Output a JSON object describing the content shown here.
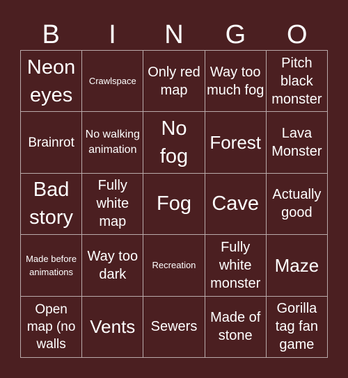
{
  "header": {
    "letters": [
      "B",
      "I",
      "N",
      "G",
      "O"
    ]
  },
  "colors": {
    "background": "#4b1f21",
    "grid_line": "#b9aaaa",
    "text": "#ffffff"
  },
  "cells": [
    [
      "Neon eyes",
      "Crawlspace",
      "Only red map",
      "Way too much fog",
      "Pitch black monster"
    ],
    [
      "Brainrot",
      "No walking animation",
      "No fog",
      "Forest",
      "Lava Monster"
    ],
    [
      "Bad story",
      "Fully white map",
      "Fog",
      "Cave",
      "Actually good"
    ],
    [
      "Made before animations",
      "Way too dark",
      "Recreation",
      "Fully white monster",
      "Maze"
    ],
    [
      "Open map (no walls",
      "Vents",
      "Sewers",
      "Made of stone",
      "Gorilla tag fan game"
    ]
  ]
}
